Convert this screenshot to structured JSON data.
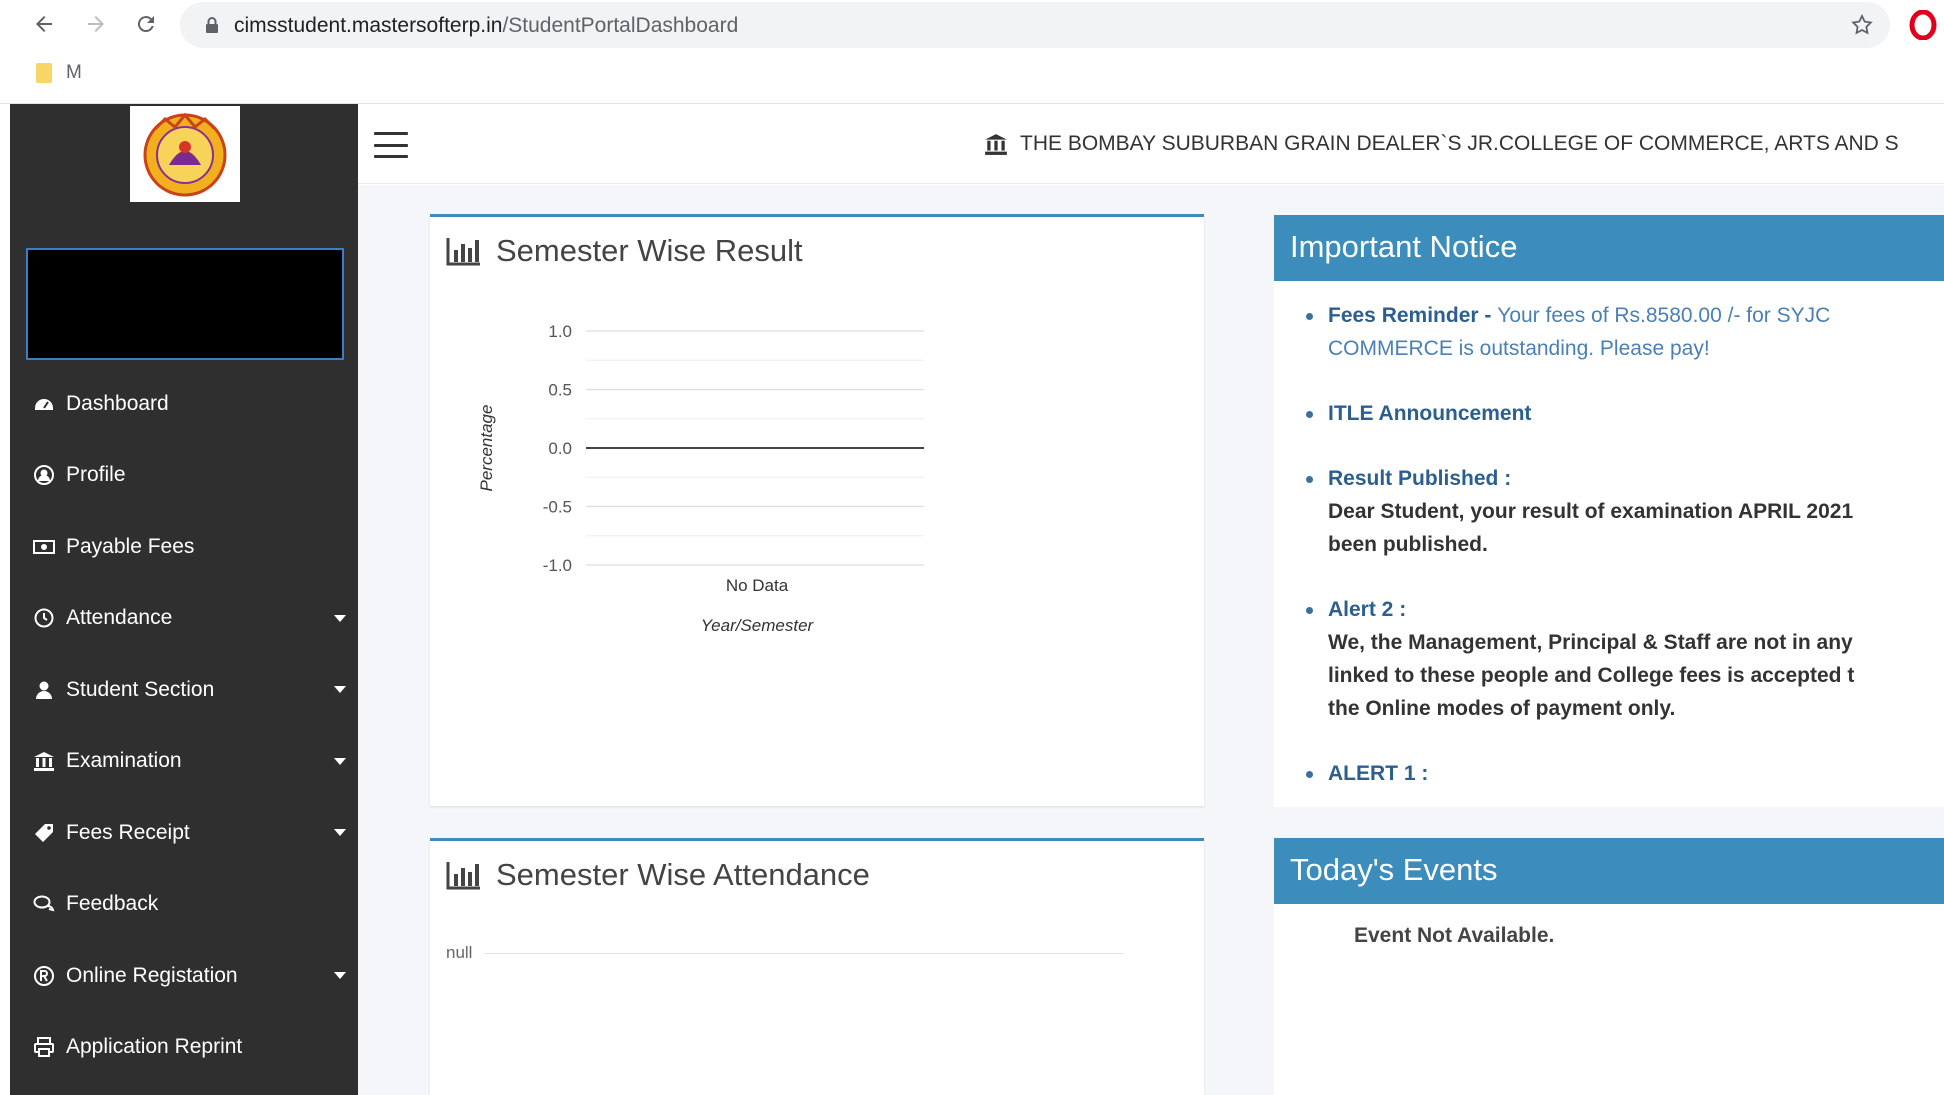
{
  "browser": {
    "url_domain": "cimsstudent.mastersofterp.in",
    "url_path": "/StudentPortalDashboard",
    "bookmark_label": "M"
  },
  "header": {
    "college_name": "THE BOMBAY SUBURBAN GRAIN DEALER`S JR.COLLEGE OF COMMERCE, ARTS AND S"
  },
  "sidebar": {
    "items": [
      {
        "label": "Dashboard",
        "icon": "dashboard-icon",
        "has_submenu": false
      },
      {
        "label": "Profile",
        "icon": "user-circle-icon",
        "has_submenu": false
      },
      {
        "label": "Payable Fees",
        "icon": "money-icon",
        "has_submenu": false
      },
      {
        "label": "Attendance",
        "icon": "clock-icon",
        "has_submenu": true
      },
      {
        "label": "Student Section",
        "icon": "user-icon",
        "has_submenu": true
      },
      {
        "label": "Examination",
        "icon": "institution-icon",
        "has_submenu": true
      },
      {
        "label": "Fees Receipt",
        "icon": "tag-icon",
        "has_submenu": true
      },
      {
        "label": "Feedback",
        "icon": "comments-icon",
        "has_submenu": false
      },
      {
        "label": "Online Registation",
        "icon": "registered-icon",
        "has_submenu": true
      },
      {
        "label": "Application Reprint",
        "icon": "print-icon",
        "has_submenu": false
      }
    ]
  },
  "result_card": {
    "title": "Semester Wise Result"
  },
  "attendance_card": {
    "title": "Semester Wise Attendance",
    "null_label": "null"
  },
  "chart_data": {
    "type": "line",
    "categories": [
      "No Data"
    ],
    "series": [
      {
        "values": [
          0
        ]
      }
    ],
    "title": "",
    "xlabel": "Year/Semester",
    "ylabel": "Percentage",
    "ylim": [
      -1.0,
      1.0
    ],
    "yticks": [
      "1.0",
      "0.5",
      "0.0",
      "-0.5",
      "-1.0"
    ],
    "grid": true
  },
  "notice": {
    "title": "Important Notice",
    "items": [
      {
        "title": "Fees Reminder - ",
        "body": "Your fees of Rs.8580.00 /- for SYJC COMMERCE is outstanding. Please pay!",
        "style": "blue"
      },
      {
        "title": "ITLE Announcement",
        "body": "",
        "style": "none"
      },
      {
        "title": "Result Published :",
        "body_lines": [
          "Dear Student, your result of examination APRIL 2021",
          "been published."
        ],
        "style": "dark"
      },
      {
        "title": "Alert 2 :",
        "body_lines": [
          "We, the Management, Principal & Staff are not in any",
          "linked to these people and College fees is accepted t",
          "the Online modes of payment only."
        ],
        "style": "dark"
      },
      {
        "title": "ALERT 1 :",
        "body": "",
        "style": "none"
      }
    ]
  },
  "events": {
    "title": "Today's Events",
    "text": "Event Not Available."
  },
  "colors": {
    "sidebar_bg": "#2f2f2f",
    "primary": "#3c8dbc",
    "content_bg": "#f4f6f9"
  }
}
